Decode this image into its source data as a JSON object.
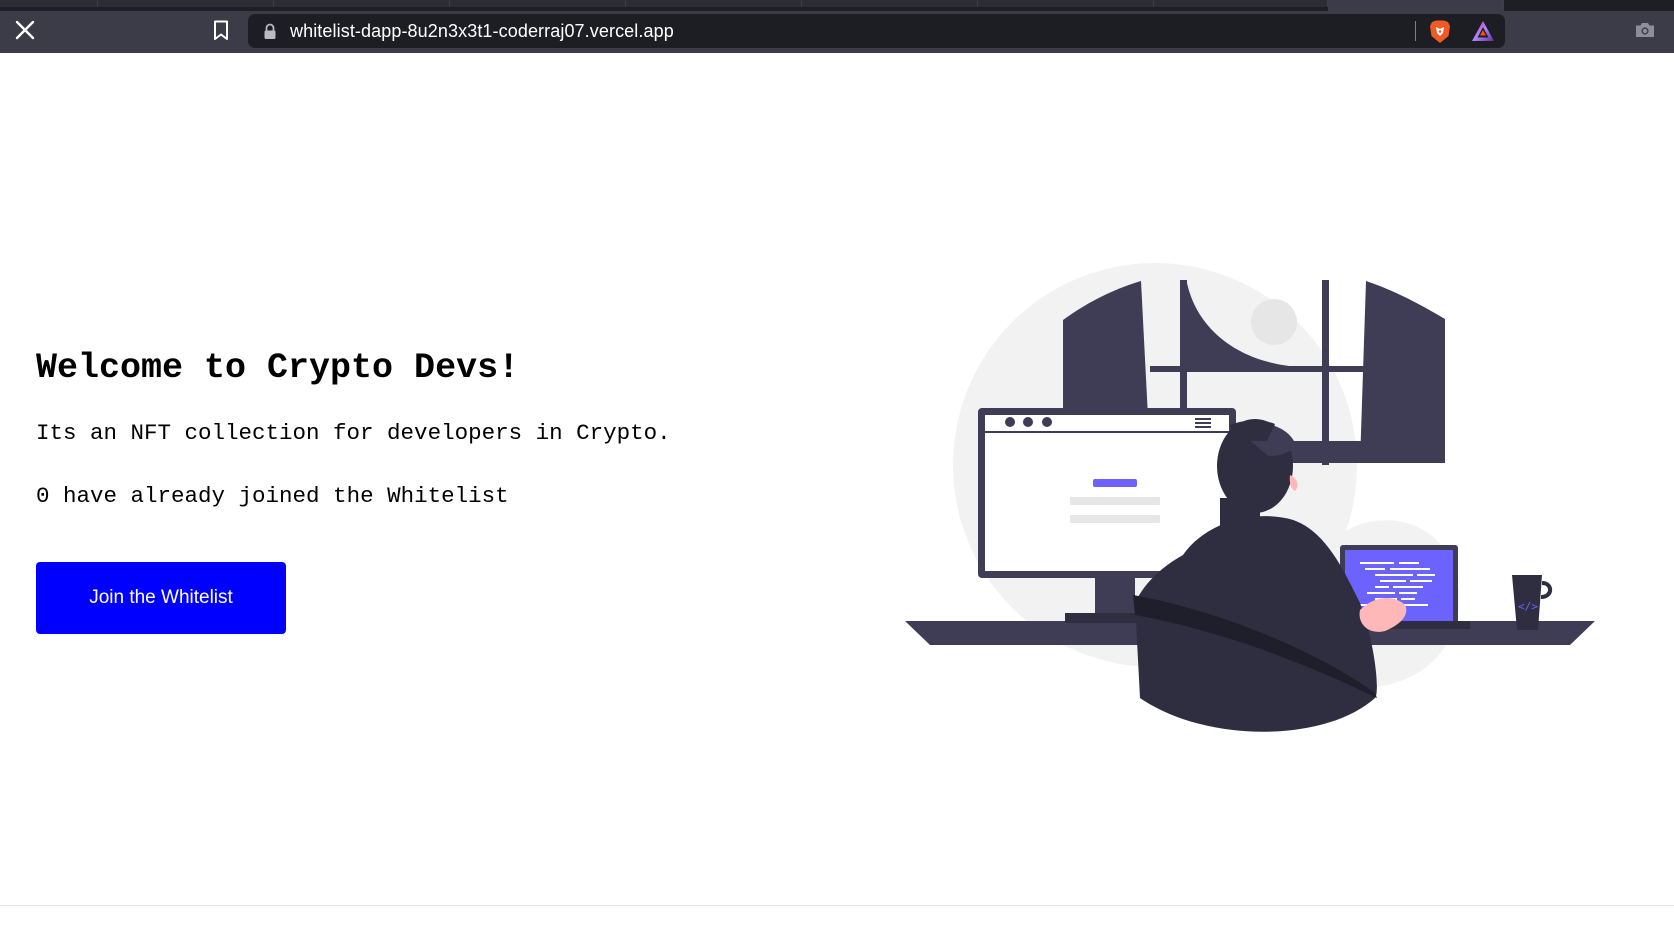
{
  "browser": {
    "url": "whitelist-dapp-8u2n3x3t1-coderraj07.vercel.app",
    "icons": [
      "close-icon",
      "bookmark-icon",
      "lock-icon",
      "brave-shield-icon",
      "brave-rewards-icon",
      "camera-icon"
    ]
  },
  "hero": {
    "title": "Welcome to Crypto Devs!",
    "description": "Its an NFT collection for developers in Crypto.",
    "joined_count": "0",
    "joined_suffix": " have already joined the Whitelist",
    "button_label": "Join the Whitelist"
  },
  "colors": {
    "button_bg": "#0000ff",
    "accent_purple": "#6c63ff",
    "dark_figure": "#3f3d56"
  }
}
